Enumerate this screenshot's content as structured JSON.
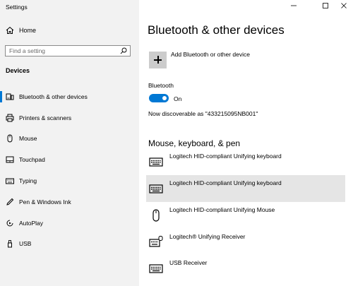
{
  "app": {
    "title": "Settings"
  },
  "sidebar": {
    "home_label": "Home",
    "search_placeholder": "Find a setting",
    "section_label": "Devices",
    "items": [
      {
        "label": "Bluetooth & other devices",
        "icon": "bluetooth-devices-icon",
        "active": true
      },
      {
        "label": "Printers & scanners",
        "icon": "printer-icon"
      },
      {
        "label": "Mouse",
        "icon": "mouse-icon"
      },
      {
        "label": "Touchpad",
        "icon": "touchpad-icon"
      },
      {
        "label": "Typing",
        "icon": "keyboard-icon"
      },
      {
        "label": "Pen & Windows Ink",
        "icon": "pen-icon"
      },
      {
        "label": "AutoPlay",
        "icon": "autoplay-icon"
      },
      {
        "label": "USB",
        "icon": "usb-icon"
      }
    ]
  },
  "main": {
    "title": "Bluetooth & other devices",
    "add_device_label": "Add Bluetooth or other device",
    "bluetooth_label": "Bluetooth",
    "bluetooth_state": "On",
    "discoverable_text": "Now discoverable as \"433215095NB001\"",
    "section_title": "Mouse, keyboard, & pen",
    "devices": [
      {
        "name": "Logitech HID-compliant Unifying keyboard",
        "icon": "keyboard-icon",
        "selected": false
      },
      {
        "name": "Logitech HID-compliant Unifying keyboard",
        "icon": "keyboard-icon",
        "selected": true
      },
      {
        "name": "Logitech HID-compliant Unifying Mouse",
        "icon": "mouse-icon",
        "selected": false
      },
      {
        "name": "Logitech® Unifying Receiver",
        "icon": "keyboard-receiver-icon",
        "selected": false
      },
      {
        "name": "USB Receiver",
        "icon": "keyboard-icon",
        "selected": false
      }
    ]
  },
  "colors": {
    "accent": "#0078d4",
    "sidebar_bg": "#f2f2f2",
    "selected_bg": "#e5e5e5"
  }
}
